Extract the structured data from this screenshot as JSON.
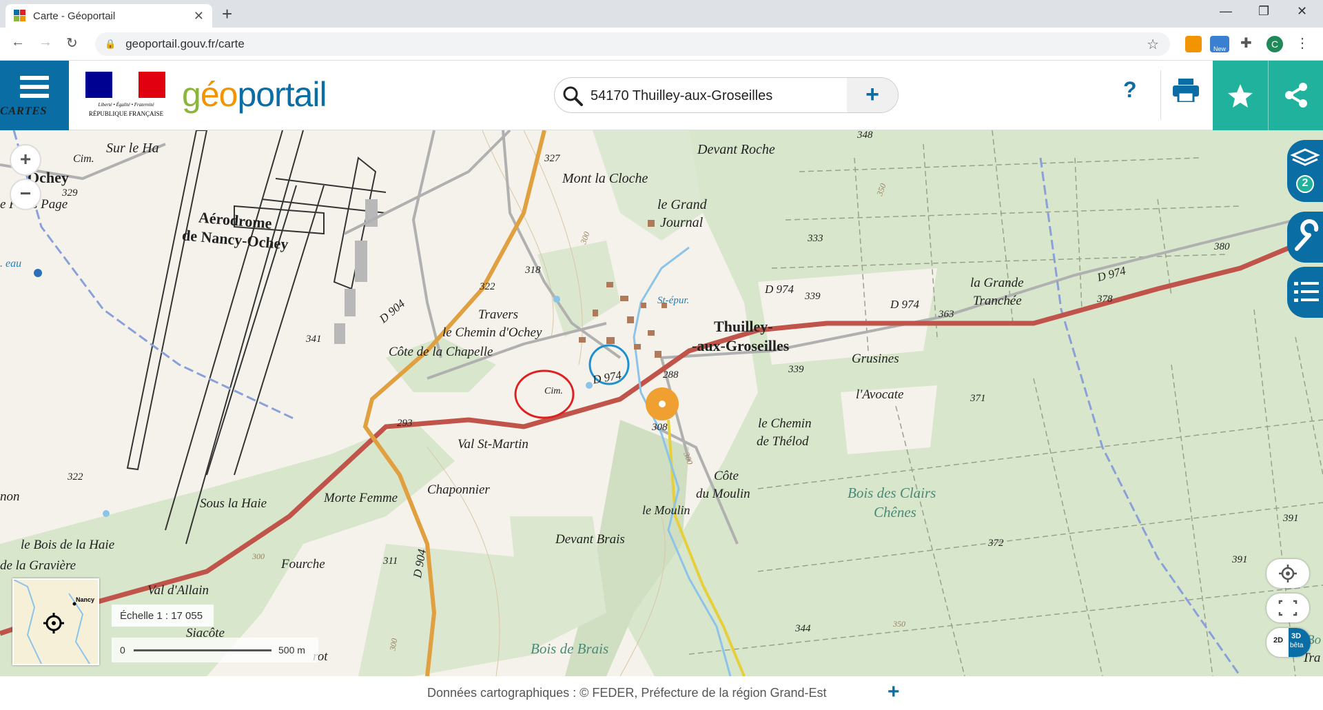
{
  "browser": {
    "tab_title": "Carte - Géoportail",
    "tab_close": "✕",
    "new_tab": "+",
    "url": "geoportail.gouv.fr/carte",
    "ext_new_badge": "New",
    "profile_initial": "C"
  },
  "header": {
    "cartes_label": "CARTES",
    "rf_motto": "Liberté • Égalité • Fraternité",
    "rf_name": "RÉPUBLIQUE FRANÇAISE",
    "logo_parts": [
      "g",
      "éo",
      "p",
      "ortail"
    ],
    "search_value": "54170 Thuilley-aux-Groseilles",
    "search_plus": "+",
    "help": "?"
  },
  "map": {
    "zoom_in": "+",
    "zoom_out": "−",
    "layers_count": "2",
    "scale_text": "Échelle 1 : 17 055",
    "scale_zero": "0",
    "scale_dist": "500 m",
    "minimap_label": "Nancy",
    "btn_2d": "2D",
    "btn_3d": "3D",
    "btn_beta": "bêta",
    "labels": {
      "ochey": "Ochey",
      "sur_le_ha": "Sur le Ha",
      "cim1": "Cim.",
      "n329": "329",
      "frais_page": "e Frais Page",
      "eau": ". eau",
      "aerodrome1": "Aérodrome",
      "aerodrome2": "de Nancy-Ochey",
      "n341": "341",
      "n327": "327",
      "mont_la_cloche": "Mont la Cloche",
      "devant_roche": "Devant Roche",
      "le_grand1": "le Grand",
      "journal": "Journal",
      "n318": "318",
      "n322a": "322",
      "travers": "Travers",
      "chemin_ochey": "le Chemin d'Ochey",
      "cote_chapelle": "Côte de la Chapelle",
      "cim2": "Cim.",
      "d974a": "D 974",
      "d904a": "D 904",
      "n293": "293",
      "n288": "288",
      "n308": "308",
      "val_st_martin": "Val St-Martin",
      "chaponnier": "Chaponnier",
      "n322b": "322",
      "mon": "non",
      "sous_la_haie": "Sous la Haie",
      "morte_femme": "Morte Femme",
      "bois_haie": "le Bois de la Haie",
      "graviere": "de la Gravière",
      "fourche": "Fourche",
      "n300a": "300",
      "n311": "311",
      "val_allain": "Val d'Allain",
      "siacote": "Siacôte",
      "rot": "rot",
      "d904b": "D 904",
      "devant_brais": "Devant Brais",
      "le_moulin": "le Moulin",
      "cote1": "Côte",
      "du_moulin": "du Moulin",
      "bois_brais": "Bois de Brais",
      "st_epur": "St-épur.",
      "thuilley1": "Thuilley-",
      "thuilley2": "-aux-Groseilles",
      "d974b": "D 974",
      "n339a": "339",
      "d974c": "D 974",
      "n363": "363",
      "n333": "333",
      "n339b": "339",
      "grusines": "Grusines",
      "avocate": "l'Avocate",
      "chemin_thelod1": "le Chemin",
      "chemin_thelod2": "de Thélod",
      "grande1": "la Grande",
      "tranchee": "Tranchée",
      "d974d": "D 974",
      "n378": "378",
      "n380": "380",
      "n348": "348",
      "n350a": "350",
      "n371": "371",
      "bois_clairs1": "Bois des Clairs",
      "bois_clairs2": "Chênes",
      "n372": "372",
      "n391a": "391",
      "n391b": "391",
      "n344": "344",
      "n350b": "350",
      "n300b": "300",
      "n300c": "300",
      "n300d": "300",
      "tra": "Tra",
      "bo": "Bo"
    }
  },
  "footer": {
    "text": "Données cartographiques : ©    FEDER,  Préfecture de la région Grand-Est",
    "plus": "+"
  },
  "colors": {
    "accent_blue": "#0a6ea5",
    "teal": "#20b29c",
    "road_red": "#c0544a",
    "road_orange": "#e0a040",
    "forest": "#d6e4c8",
    "highlight_red": "#e02020",
    "highlight_blue": "#1e8fd0"
  }
}
